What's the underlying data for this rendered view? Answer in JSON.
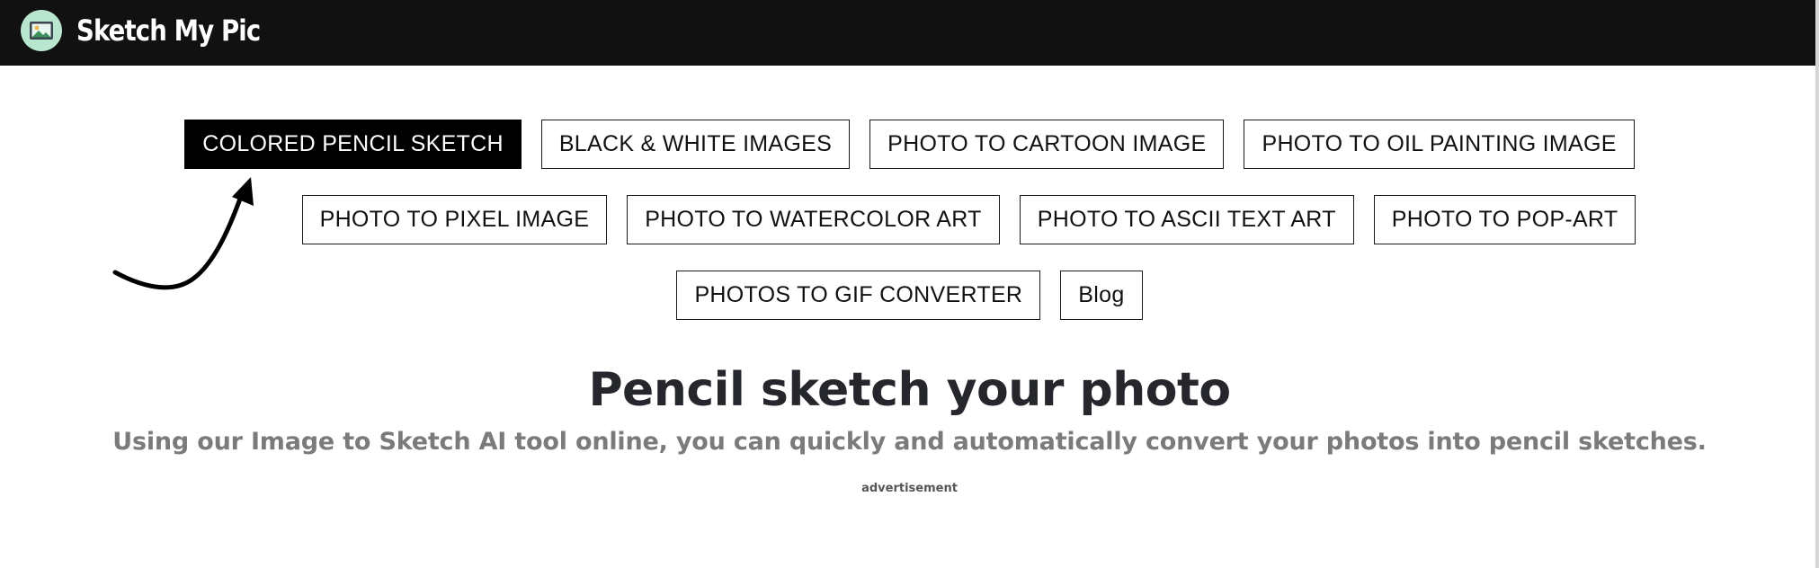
{
  "header": {
    "logo_icon": "landscape-picture-icon",
    "site_name": "Sketch My Pic",
    "background": "#111111"
  },
  "nav": {
    "rows": [
      [
        {
          "label": "COLORED PENCIL SKETCH",
          "active": true
        },
        {
          "label": "BLACK & WHITE IMAGES",
          "active": false
        },
        {
          "label": "PHOTO TO CARTOON IMAGE",
          "active": false
        },
        {
          "label": "PHOTO TO OIL PAINTING IMAGE",
          "active": false
        }
      ],
      [
        {
          "label": "PHOTO TO PIXEL IMAGE",
          "active": false
        },
        {
          "label": "PHOTO TO WATERCOLOR ART",
          "active": false
        },
        {
          "label": "PHOTO TO ASCII TEXT ART",
          "active": false
        },
        {
          "label": "PHOTO TO POP-ART",
          "active": false
        }
      ],
      [
        {
          "label": "PHOTOS TO GIF CONVERTER",
          "active": false
        },
        {
          "label": "Blog",
          "active": false
        }
      ]
    ]
  },
  "hero": {
    "title": "Pencil sketch your photo",
    "subtitle": "Using our Image to Sketch AI tool online, you can quickly and automatically convert your photos into pencil sketches.",
    "ad_label": "advertisement"
  },
  "decor": {
    "arrow_icon": "curved-arrow-icon"
  },
  "colors": {
    "title": "#25272c",
    "subtitle": "#7b7b7b",
    "active_button_bg": "#000000",
    "logo_circle": "#b9e6cf"
  }
}
